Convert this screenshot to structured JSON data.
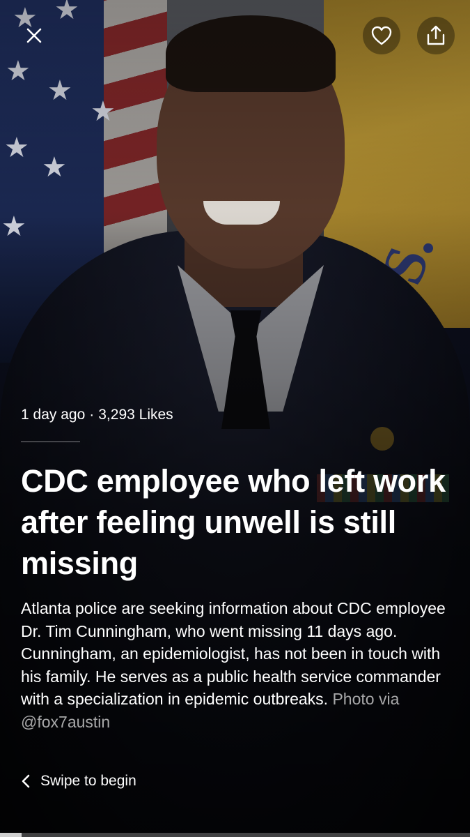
{
  "story": {
    "time_ago": "1 day ago",
    "separator": "·",
    "likes": "3,293 Likes",
    "headline": "CDC employee who left work after feeling unwell is still missing",
    "body": "Atlanta police are seeking information about CDC employee Dr. Tim Cunningham, who went missing 11 days ago. Cunningham, an epidemiologist, has not been in touch with his family. He serves as a public health service commander with a specialization in epidemic outbreaks.",
    "credit": "Photo via @fox7austin"
  },
  "controls": {
    "close_icon": "close-icon",
    "like_icon": "heart-icon",
    "share_icon": "share-icon",
    "swipe_icon": "chevron-left-icon",
    "swipe_label": "Swipe to begin"
  },
  "progress": {
    "value": 0.046
  },
  "colors": {
    "text": "#ffffff",
    "muted": "#a6a6a6",
    "overlay": "#000000"
  }
}
